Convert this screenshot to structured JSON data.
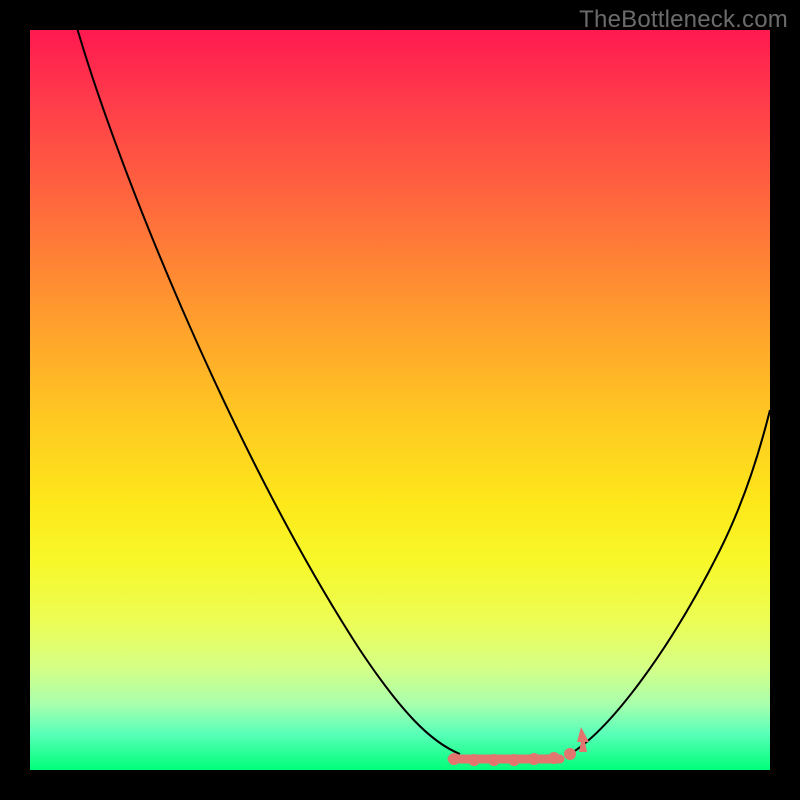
{
  "watermark": "TheBottleneck.com",
  "colors": {
    "background": "#000000",
    "curve": "#000000",
    "marker": "#e2766f",
    "gradient_top": "#ff1950",
    "gradient_bottom": "#00ff7a"
  },
  "chart_data": {
    "type": "line",
    "title": "",
    "xlabel": "",
    "ylabel": "",
    "xlim": [
      0,
      100
    ],
    "ylim": [
      0,
      100
    ],
    "x": [
      0,
      5,
      10,
      15,
      20,
      25,
      30,
      35,
      40,
      45,
      50,
      53,
      56,
      58,
      60,
      62,
      64,
      66,
      68,
      70,
      72,
      75,
      80,
      85,
      90,
      95,
      100
    ],
    "values": [
      108,
      100,
      91,
      82,
      73,
      64,
      55,
      46,
      37,
      28,
      19,
      12,
      6,
      3,
      1,
      0,
      0,
      0,
      0,
      1,
      3,
      7,
      14,
      22,
      31,
      41,
      52
    ],
    "optimal_range_x": [
      56,
      72
    ],
    "arrow_x": 72,
    "annotations": []
  }
}
